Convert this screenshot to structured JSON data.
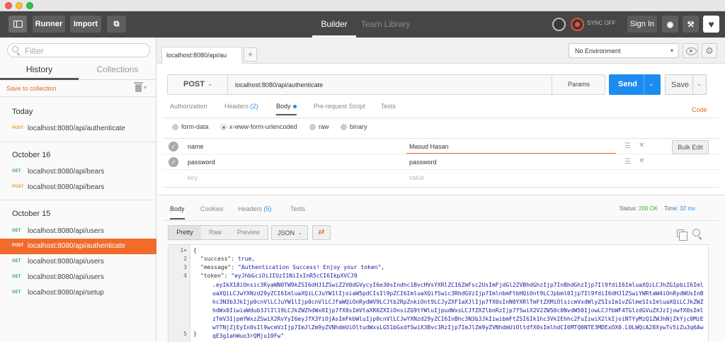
{
  "header": {
    "runner_label": "Runner",
    "import_label": "Import",
    "builder_tab": "Builder",
    "team_library_tab": "Team Library",
    "sync_label": "SYNC OFF",
    "sign_in_label": "Sign In"
  },
  "sidebar": {
    "filter_placeholder": "Filter",
    "tab_history": "History",
    "tab_collections": "Collections",
    "save_to_collection": "Save to collection",
    "groups": [
      {
        "title": "Today",
        "items": [
          {
            "method": "POST",
            "url": "localhost:8080/api/authenticate"
          }
        ]
      },
      {
        "title": "October 16",
        "items": [
          {
            "method": "GET",
            "url": "localhost:8080/api/bears"
          },
          {
            "method": "POST",
            "url": "localhost:8080/api/bears"
          }
        ]
      },
      {
        "title": "October 15",
        "items": [
          {
            "method": "GET",
            "url": "localhost:8080/api/users"
          },
          {
            "method": "POST",
            "url": "localhost:8080/api/authenticate",
            "active": true
          },
          {
            "method": "GET",
            "url": "localhost:8080/api/users"
          },
          {
            "method": "GET",
            "url": "localhost:8080/api/users"
          },
          {
            "method": "GET",
            "url": "localhost:8080/api/setup"
          }
        ]
      }
    ]
  },
  "main": {
    "request_tab": "localhost:8080/api/au",
    "new_tab": "+",
    "environment": "No Environment",
    "method": "POST",
    "url": "localhost:8080/api/authenticate",
    "params_label": "Params",
    "send_label": "Send",
    "save_label": "Save",
    "request_tabs": {
      "authorization": "Authorization",
      "headers": "Headers",
      "headers_count": "(2)",
      "body": "Body",
      "prerequest": "Pre-request Script",
      "tests": "Tests"
    },
    "code_link": "Code",
    "body_types": {
      "form_data": "form-data",
      "urlencoded": "x-www-form-urlencoded",
      "raw": "raw",
      "binary": "binary"
    },
    "params": [
      {
        "key": "name",
        "value": "Masud Hasan"
      },
      {
        "key": "password",
        "value": "password"
      }
    ],
    "key_placeholder": "key",
    "value_placeholder": "value",
    "bulk_edit": "Bulk Edit"
  },
  "response": {
    "tabs": {
      "body": "Body",
      "cookies": "Cookies",
      "headers": "Headers",
      "headers_count": "(5)",
      "tests": "Tests"
    },
    "status_label": "Status:",
    "status_value": "200 OK",
    "time_label": "Time:",
    "time_value": "32 ms",
    "view_modes": {
      "pretty": "Pretty",
      "raw": "Raw",
      "preview": "Preview"
    },
    "format": "JSON",
    "lines": {
      "l1": "{",
      "l2_key": "\"success\"",
      "l2_val": "true,",
      "l3_key": "\"message\"",
      "l3_val": "\"Authentication Success! Enjoy your token\",",
      "l4_key": "\"token\"",
      "l4_val": "\"eyJhbGciOiJIUzI1NiIsInR5cCI6IkpXVCJ9",
      "l5": "}"
    },
    "token_rest": ".eyIkX18iOnsic3RyaWN0TW9kZSI6dHJ1ZSwiZ2V0dGVycyI6e30sIndhc1BvcHVsYXRlZCI6ZmFsc2UsImFjdGl2ZVBhdGhzIjp7InBhdGhzIjp7Il9fdiI6ImluaXQiLCJhZG1pbiI6ImluaXQiLCJwYXNzd29yZCI6ImluaXQiLCJuYW1lIjoiaW5pdCIsIl9pZCI6ImluaXQifSwic3RhdGVzIjp7ImlnbmFtbHQiOnt9LCJpbml0Ijp7Il9fdiI6dHJ1ZSwiYWRtaW4iOnRydWUsInBhc3N3b3JkIjp0cnVlLCJuYW1lIjp0cnVlLCJfaWQiOnRydWV9LCJtb2RpZnkiOnt9LCJyZXF1aXJlIjp7fX0sInN0YXRlTmFtZXMiOlsicmVxdWlyZSIsIm1vZGlmeSIsImluaXQiLCJkZWZhdWx0IiwiaWdub3JlIl19LCJkZWZhdWx0Ijp7fX0sImVtaXR0ZXIiOnsiZG9tYWluIjpudWxsLCJfZXZlbnRzIjp7fSwiX2V2ZW50c0NvdW50IjowLCJfbWF4TGlzdGVuZXJzIjowfX0sImlzTmV3IjpmYWxzZSwiX2RvYyI6eyJfX3YiOjAsImFkbWluIjp0cnVlLCJwYXNzd29yZCI6InBhc3N3b3JkIiwibmFtZSI6Ik1hc3VkIEhhc2FuIiwiX2lkIjoiNTYyMzQ1ZWJhNjZkYjc0MzEwYTNjZjEyIn0sIl9wcmVzIjp7ImJlZm9yZVNhdmUiOltudWxsLG51bGxdfSwiX3Bvc3RzIjp7ImJlZm9yZVNhdmUiOltdfX0sImlhdCI6MTQ0NTE3MDExOX0.L0LWQcA28XywTv5iZu3q6AwqE3g1ahWuo3rQMju10Fw\""
  }
}
